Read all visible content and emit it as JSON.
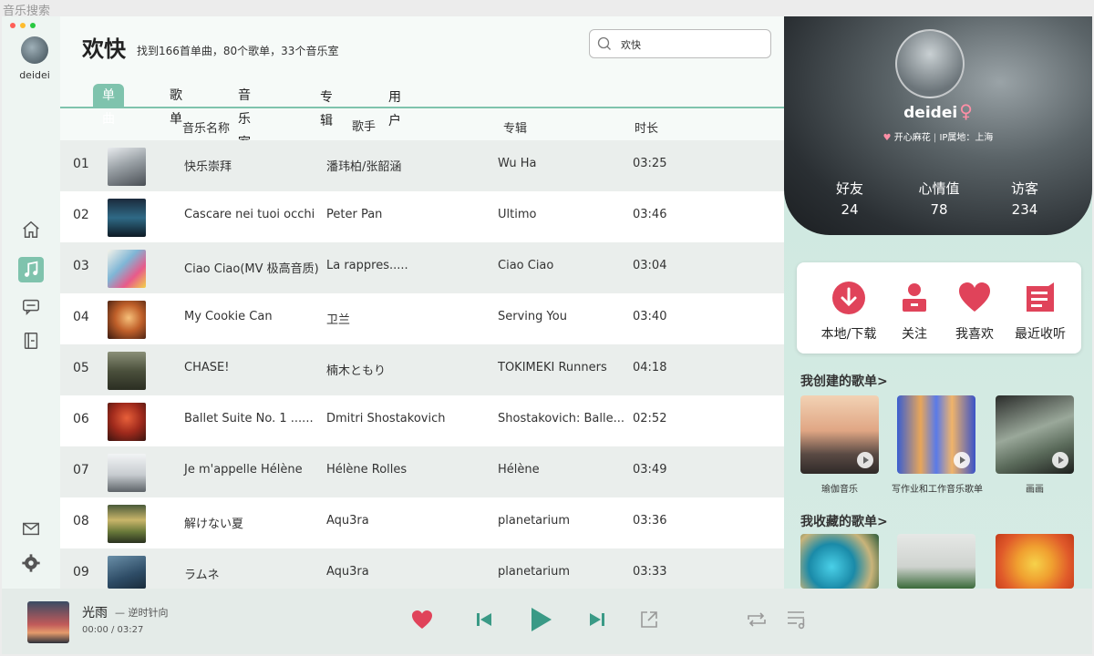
{
  "window": {
    "title": "音乐搜索"
  },
  "user": {
    "name": "deidei"
  },
  "search": {
    "title": "欢快",
    "summary": "找到166首单曲，80个歌单，33个音乐室",
    "query": "欢快"
  },
  "tabs": [
    "单曲",
    "歌单",
    "音乐室",
    "专辑",
    "用户"
  ],
  "columns": {
    "name": "音乐名称",
    "artist": "歌手",
    "album": "专辑",
    "duration": "时长"
  },
  "songs": [
    {
      "index": "01",
      "title": "快乐崇拜",
      "artist": "潘玮柏/张韶涵",
      "album": "Wu Ha",
      "duration": "03:25"
    },
    {
      "index": "02",
      "title": "Cascare nei tuoi occhi",
      "artist": "Peter Pan",
      "album": "Ultimo",
      "duration": "03:46"
    },
    {
      "index": "03",
      "title": "Ciao Ciao(MV 极高音质)",
      "artist": "La rappres.....",
      "album": "Ciao Ciao",
      "duration": "03:04"
    },
    {
      "index": "04",
      "title": "My Cookie Can",
      "artist": "卫兰",
      "album": "Serving You",
      "duration": "03:40"
    },
    {
      "index": "05",
      "title": "CHASE!",
      "artist": "楠木ともり",
      "album": "TOKIMEKI Runners",
      "duration": "04:18"
    },
    {
      "index": "06",
      "title": "Ballet Suite No. 1 ......",
      "artist": "Dmitri Shostakovich",
      "album": "Shostakovich: Balle...",
      "duration": "02:52"
    },
    {
      "index": "07",
      "title": "Je m'appelle Hélène",
      "artist": "Hélène Rolles",
      "album": "Hélène",
      "duration": "03:49"
    },
    {
      "index": "08",
      "title": "解けない夏",
      "artist": "Aqu3ra",
      "album": "planetarium",
      "duration": "03:36"
    },
    {
      "index": "09",
      "title": "ラムネ",
      "artist": "Aqu3ra",
      "album": "planetarium",
      "duration": "03:33"
    }
  ],
  "profile": {
    "name": "deidei",
    "gender_symbol": "♀",
    "mood": "开心麻花",
    "ip": "IP属地：上海",
    "stats": [
      {
        "label": "好友",
        "value": "24"
      },
      {
        "label": "心情值",
        "value": "78"
      },
      {
        "label": "访客",
        "value": "234"
      }
    ]
  },
  "quick_actions": [
    "本地/下载",
    "关注",
    "我喜欢",
    "最近收听"
  ],
  "created_playlists": {
    "title": "我创建的歌单>",
    "items": [
      "瑜伽音乐",
      "写作业和工作音乐歌单",
      "画画"
    ]
  },
  "collected_playlists": {
    "title": "我收藏的歌单>"
  },
  "now_playing": {
    "title": "光雨",
    "artist": "— 逆时针向",
    "time": "00:00 / 03:27"
  },
  "colors": {
    "accent": "#7fc3ad",
    "heart": "#e0435a",
    "play": "#3a9a86"
  }
}
